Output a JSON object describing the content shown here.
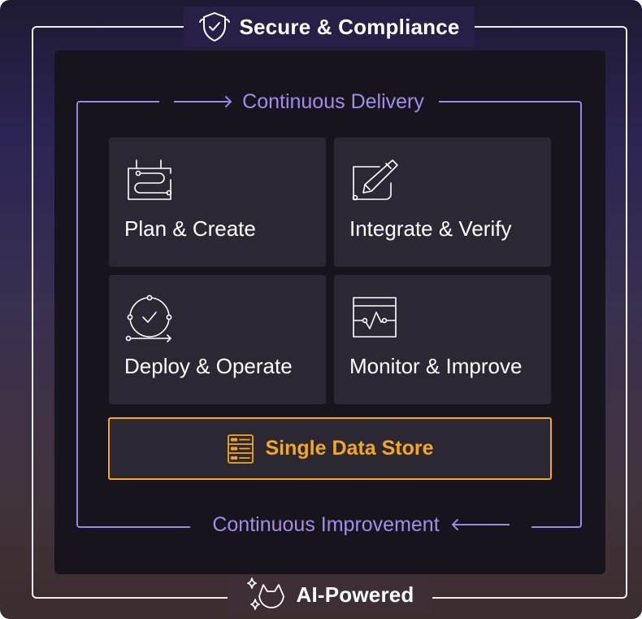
{
  "outer": {
    "top_title": "Secure & Compliance",
    "top_icon": "shield-check-icon",
    "bottom_title": "AI-Powered",
    "bottom_icon": "sparkle-fox-icon"
  },
  "loop": {
    "top_label": "Continuous Delivery",
    "bottom_label": "Continuous Improvement",
    "color": "#9e86e6"
  },
  "stages": [
    {
      "label": "Plan & Create",
      "icon": "calendar-flow-icon"
    },
    {
      "label": "Integrate & Verify",
      "icon": "pencil-edit-icon"
    },
    {
      "label": "Deploy & Operate",
      "icon": "cycle-check-icon"
    },
    {
      "label": "Monitor & Improve",
      "icon": "monitor-pulse-icon"
    }
  ],
  "store": {
    "label": "Single Data Store",
    "icon": "server-stack-icon",
    "color": "#f5a623"
  }
}
